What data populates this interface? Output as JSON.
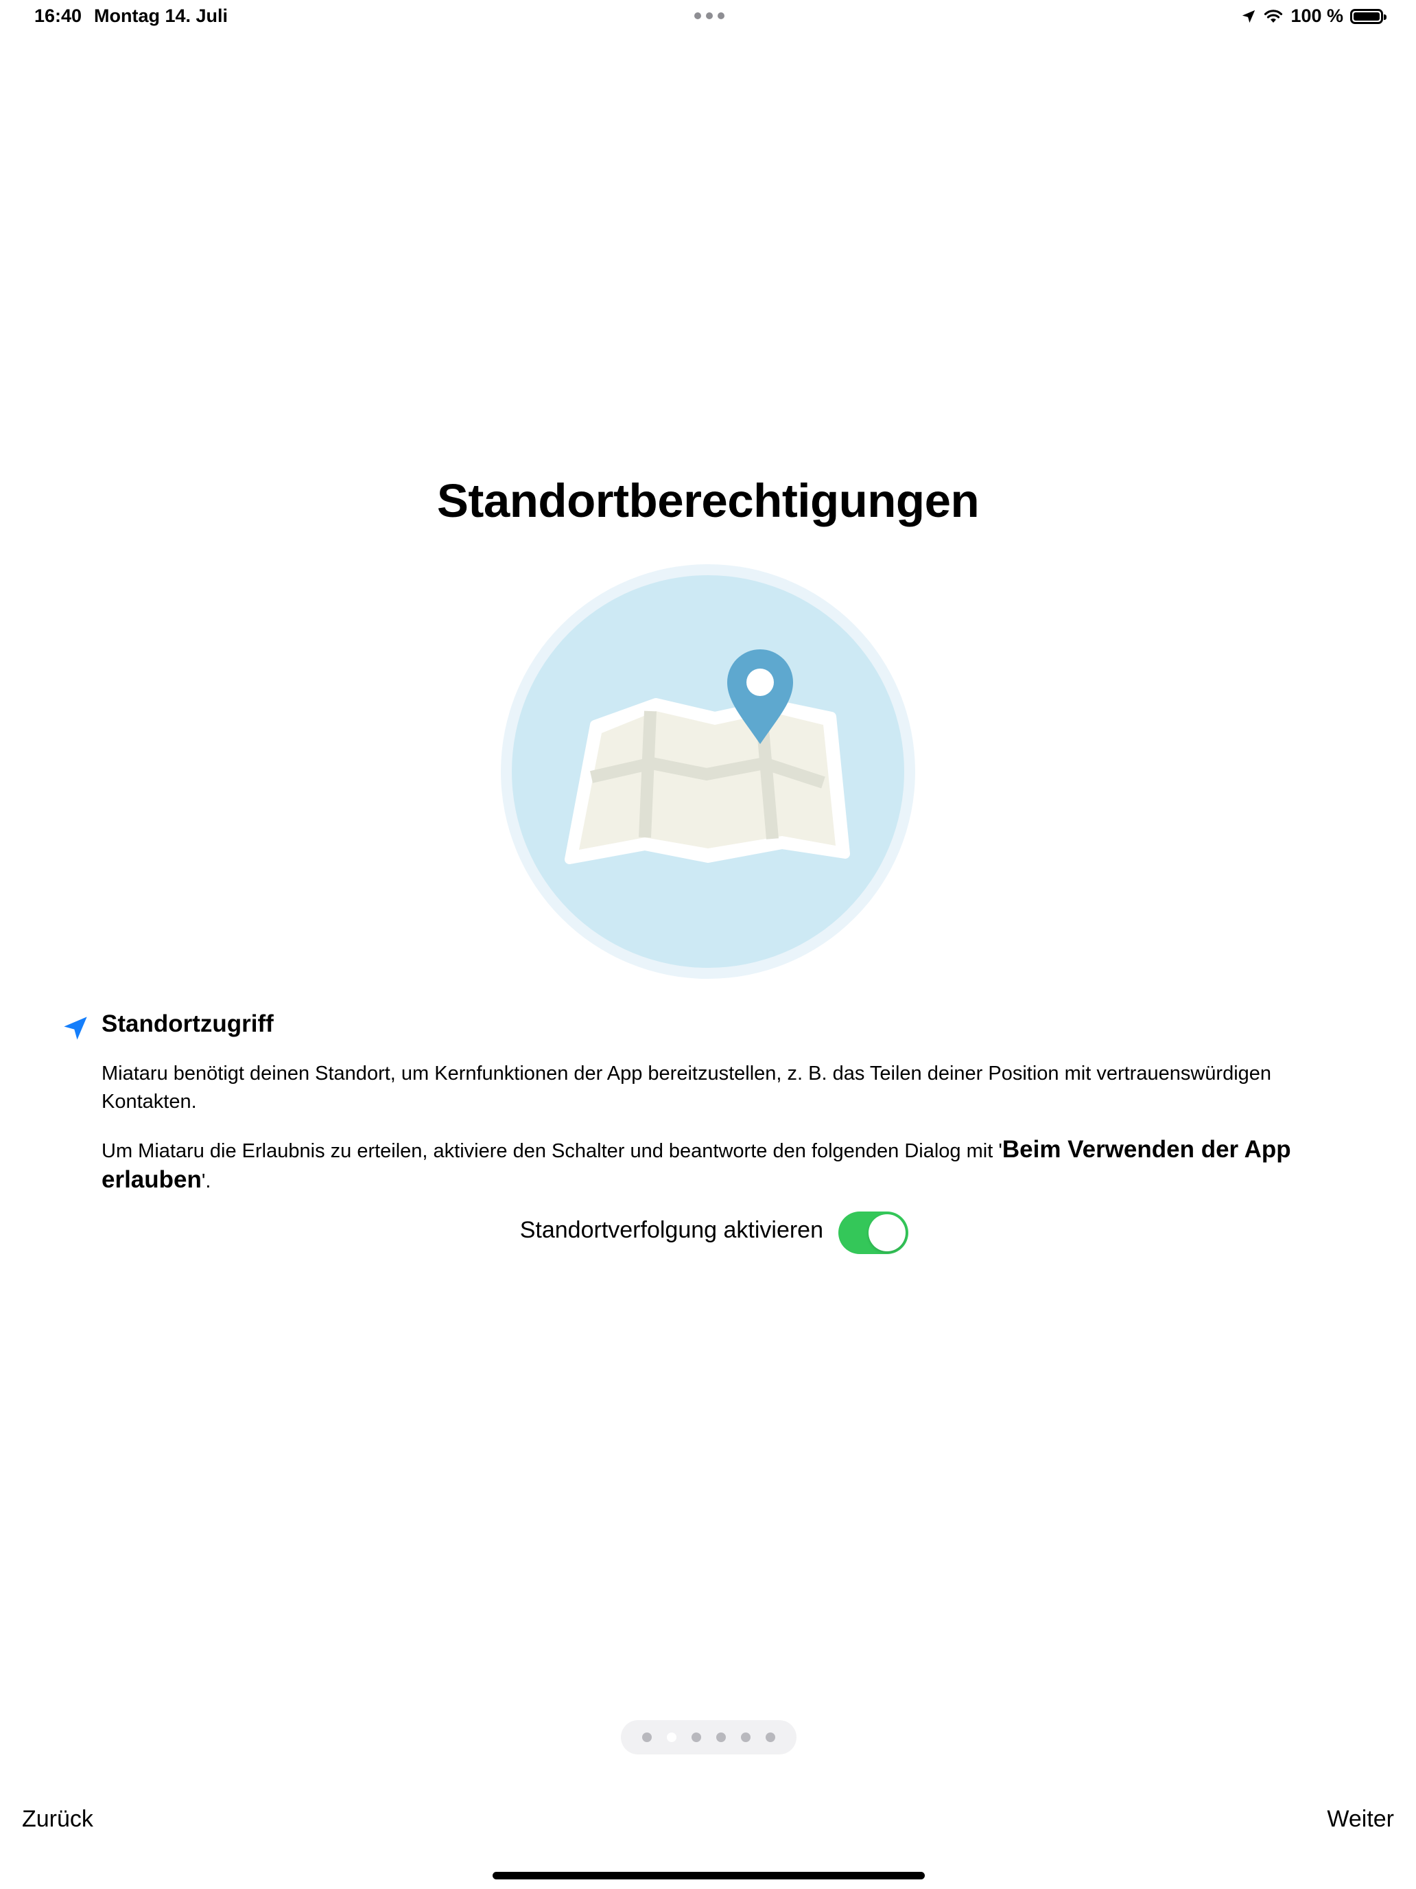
{
  "status_bar": {
    "time": "16:40",
    "date": "Montag 14. Juli",
    "battery_text": "100 %",
    "icons": [
      "location-arrow-icon",
      "wifi-icon",
      "battery-icon"
    ]
  },
  "title": "Standortberechtigungen",
  "illustration": {
    "icon": "map-pin-icon",
    "colors": {
      "circle": "#cde9f4",
      "circle_ring": "#eaf4fa",
      "map": "#f2f1e6",
      "roads": "#dfe0d4",
      "pin": "#5ea8cf"
    }
  },
  "section": {
    "icon": "location-arrow-icon",
    "title": "Standortzugriff",
    "paragraph1": "Miataru benötigt deinen Standort, um Kernfunktionen der App bereitzustellen, z. B. das Teilen deiner Position mit vertrauenswürdigen Kontakten.",
    "paragraph2_prefix": "Um Miataru die Erlaubnis zu erteilen, aktiviere den Schalter und beantworte den folgenden Dialog mit '",
    "paragraph2_bold": "Beim Verwenden der App erlauben",
    "paragraph2_suffix": "'."
  },
  "toggle": {
    "label": "Standortverfolgung aktivieren",
    "state": "on",
    "color": "#34c759"
  },
  "page_indicator": {
    "total": 6,
    "current": 2
  },
  "nav": {
    "back_label": "Zurück",
    "next_label": "Weiter"
  },
  "colors": {
    "accent": "#147efb",
    "toggle_on": "#34c759"
  }
}
